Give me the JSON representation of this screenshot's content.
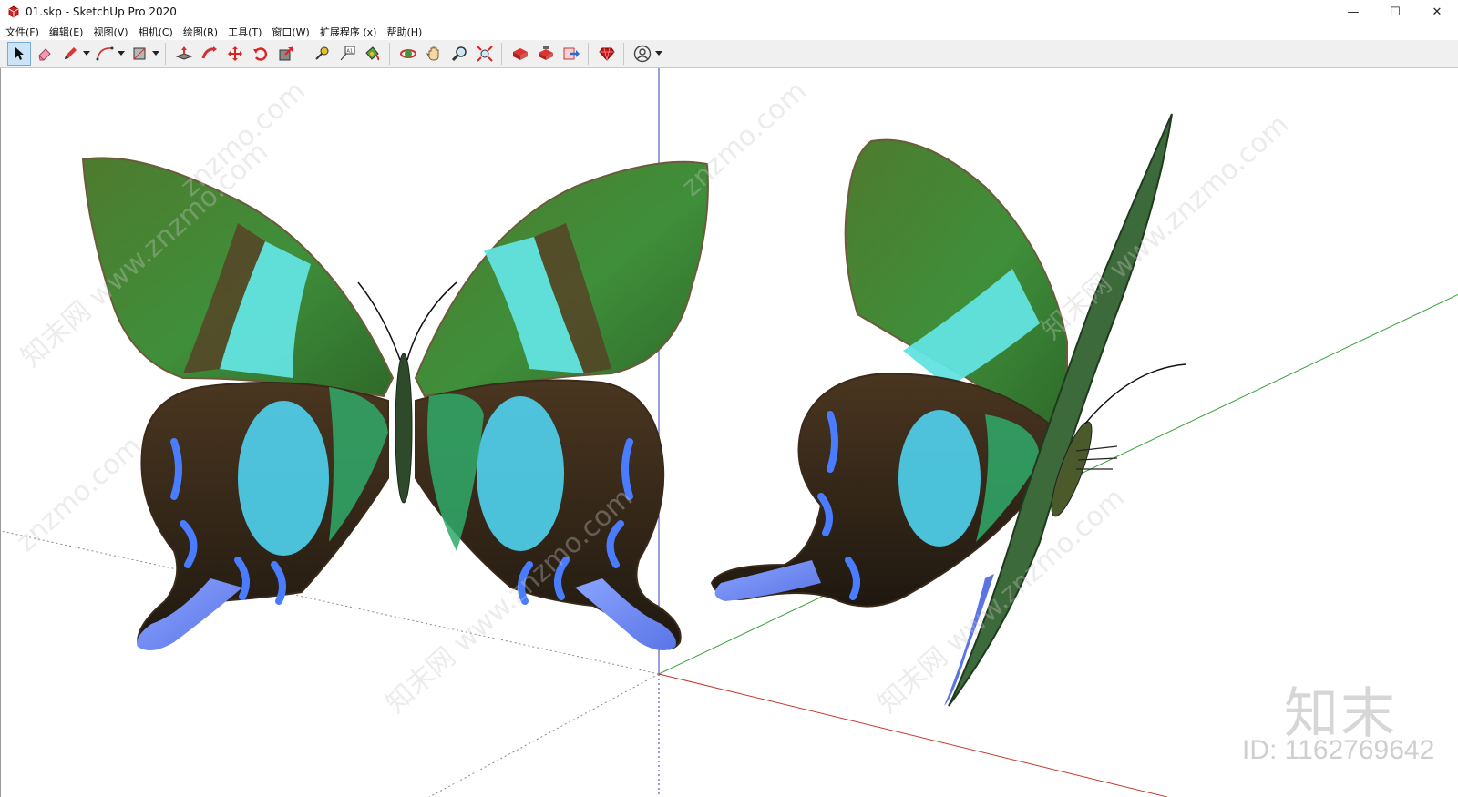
{
  "window": {
    "title": "01.skp - SketchUp Pro 2020",
    "controls": {
      "minimize": "—",
      "maximize": "☐",
      "close": "✕"
    }
  },
  "menu": [
    "文件(F)",
    "编辑(E)",
    "视图(V)",
    "相机(C)",
    "绘图(R)",
    "工具(T)",
    "窗口(W)",
    "扩展程序 (x)",
    "帮助(H)"
  ],
  "toolbar": {
    "icons": [
      "select-icon",
      "eraser-icon",
      "pencil-icon",
      "arc-icon",
      "rectangle-icon",
      "push-pull-icon",
      "follow-me-icon",
      "move-icon",
      "rotate-icon",
      "scale-icon",
      "tape-measure-icon",
      "text-icon",
      "paint-bucket-icon",
      "orbit-icon",
      "pan-icon",
      "zoom-icon",
      "zoom-extents-icon",
      "3d-warehouse-icon",
      "extension-warehouse-icon",
      "send-to-layout-icon",
      "ruby-console-icon",
      "account-icon"
    ]
  },
  "viewport": {
    "colors": {
      "red_axis": "#c0392b",
      "green_axis": "#3aa23a",
      "blue_axis": "#3b3bb0"
    },
    "watermark": {
      "logo": "知末",
      "id": "ID: 1162769642",
      "repeat": [
        "知末网 www.znzmo.com",
        "znzmo.com"
      ]
    }
  }
}
